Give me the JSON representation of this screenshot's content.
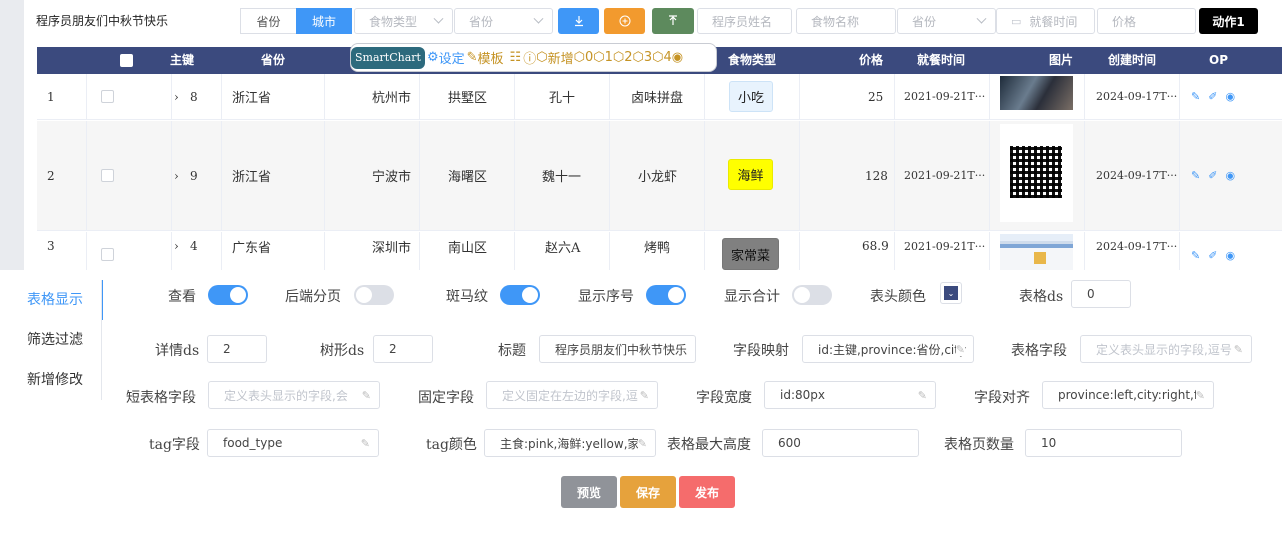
{
  "app_title": "程序员朋友们中秋节快乐",
  "toolbar": {
    "seg_province": "省份",
    "seg_city": "城市",
    "food_type_placeholder": "食物类型",
    "province_placeholder": "省份",
    "programmer_placeholder": "程序员姓名",
    "food_name_placeholder": "食物名称",
    "province2_placeholder": "省份",
    "dining_time_placeholder": "就餐时间",
    "price_placeholder": "价格",
    "action1": "动作1",
    "colors": {
      "blue": "#3f97f7",
      "orange": "#f29a2e",
      "green": "#5d8a5d",
      "black": "#000000"
    }
  },
  "smartchart": {
    "logo": "SmartChart",
    "settings": "设定",
    "template": "模板",
    "add": "新增",
    "n0": "0",
    "n1": "1",
    "n2": "2",
    "n3": "3",
    "n4": "4"
  },
  "table": {
    "headers": {
      "pk": "主键",
      "province": "省份",
      "food_type": "食物类型",
      "price": "价格",
      "dining_time": "就餐时间",
      "image": "图片",
      "created": "创建时间",
      "op": "OP"
    },
    "header_color": "#3b4a7e",
    "rows": [
      {
        "idx": "1",
        "pk": "8",
        "province": "浙江省",
        "city": "杭州市",
        "district": "拱墅区",
        "name": "孔十",
        "food": "卤味拼盘",
        "type": "小吃",
        "type_color": "#e8f3fd",
        "price": "25",
        "dining": "2021-09-21T···",
        "created": "2024-09-17T···"
      },
      {
        "idx": "2",
        "pk": "9",
        "province": "浙江省",
        "city": "宁波市",
        "district": "海曙区",
        "name": "魏十一",
        "food": "小龙虾",
        "type": "海鲜",
        "type_color": "#ffff00",
        "price": "128",
        "dining": "2021-09-21T···",
        "created": "2024-09-17T···"
      },
      {
        "idx": "3",
        "pk": "4",
        "province": "广东省",
        "city": "深圳市",
        "district": "南山区",
        "name": "赵六A",
        "food": "烤鸭",
        "type": "家常菜",
        "type_color": "#808080",
        "price": "68.9",
        "dining": "2021-09-21T···",
        "created": "2024-09-17T···"
      }
    ]
  },
  "sidebar": {
    "items": [
      {
        "label": "表格显示"
      },
      {
        "label": "筛选过滤"
      },
      {
        "label": "新增修改"
      }
    ]
  },
  "form": {
    "view": "查看",
    "backend_paging": "后端分页",
    "zebra": "斑马纹",
    "show_index": "显示序号",
    "show_total": "显示合计",
    "header_color": "表头颜色",
    "table_ds": "表格ds",
    "table_ds_value": "0",
    "detail_ds": "详情ds",
    "detail_ds_value": "2",
    "tree_ds": "树形ds",
    "tree_ds_value": "2",
    "title": "标题",
    "title_value": "程序员朋友们中秋节快乐",
    "field_map": "字段映射",
    "field_map_value": "id:主键,province:省份,city",
    "table_fields": "表格字段",
    "table_fields_placeholder": "定义表头显示的字段,逗号",
    "short_fields": "短表格字段",
    "short_fields_placeholder": "定义表头显示的字段,会",
    "fixed_fields": "固定字段",
    "fixed_fields_placeholder": "定义固定在左边的字段,逗",
    "field_width": "字段宽度",
    "field_width_value": "id:80px",
    "field_align": "字段对齐",
    "field_align_value": "province:left,city:right,fo",
    "tag_field": "tag字段",
    "tag_field_value": "food_type",
    "tag_color": "tag颜色",
    "tag_color_value": "主食:pink,海鲜:yellow,家",
    "max_height": "表格最大高度",
    "max_height_value": "600",
    "page_size": "表格页数量",
    "page_size_value": "10",
    "toggles": {
      "view": true,
      "backend_paging": false,
      "zebra": true,
      "show_index": true,
      "show_total": false
    }
  },
  "buttons": {
    "preview": "预览",
    "save": "保存",
    "publish": "发布",
    "preview_color": "#909399",
    "save_color": "#e6a23c",
    "publish_color": "#f56c6c"
  }
}
